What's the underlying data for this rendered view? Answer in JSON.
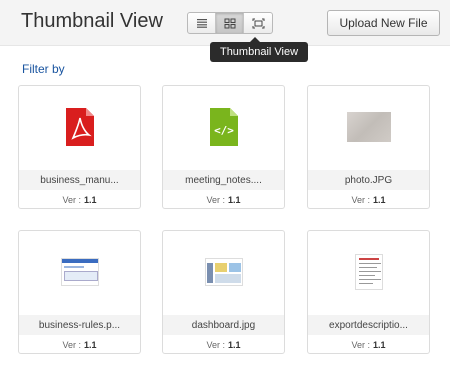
{
  "header": {
    "title": "Thumbnail View",
    "upload_label": "Upload New File",
    "views": [
      {
        "name": "list-view",
        "icon": "list-icon"
      },
      {
        "name": "thumbnail-view",
        "icon": "grid-icon",
        "active": true
      },
      {
        "name": "preview-view",
        "icon": "expand-icon"
      }
    ],
    "tooltip": "Thumbnail View"
  },
  "filter": {
    "label": "Filter by"
  },
  "version_prefix": "Ver :",
  "files": [
    {
      "name": "business_manu...",
      "version": "1.1",
      "icon": "pdf-file-icon",
      "accent": "#e02020"
    },
    {
      "name": "meeting_notes....",
      "version": "1.1",
      "icon": "code-file-icon",
      "accent": "#7ab51d"
    },
    {
      "name": "photo.JPG",
      "version": "1.1",
      "icon": "photo-thumbnail"
    },
    {
      "name": "business-rules.p...",
      "version": "1.1",
      "icon": "screenshot-thumbnail"
    },
    {
      "name": "dashboard.jpg",
      "version": "1.1",
      "icon": "dashboard-thumbnail"
    },
    {
      "name": "exportdescriptio...",
      "version": "1.1",
      "icon": "document-thumbnail"
    }
  ],
  "colors": {
    "link": "#1a55a0",
    "tooltip_bg": "#2b2b2b"
  }
}
